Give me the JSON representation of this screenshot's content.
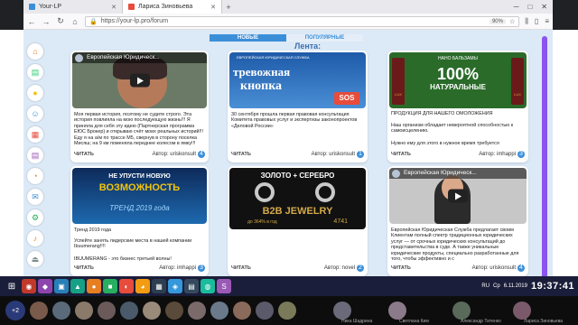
{
  "browser": {
    "tabs": [
      {
        "label": "Your-LP",
        "active": false
      },
      {
        "label": "Лариса Зиновьева",
        "active": true
      }
    ],
    "url": "https://your-lp.pro/forum",
    "zoom": "90%",
    "new_tab_icon": "plus"
  },
  "forum": {
    "tab_new": "НОВЫЕ",
    "tab_popular": "ПОПУЛЯРНЫЕ",
    "feed_title": "Лента:"
  },
  "cards": [
    {
      "media_type": "video",
      "video_title": "Европейская Юридическ...",
      "text": "Моя первая история, поэтому не судите строго. Эта история повлияла на мою последующую жизнь!!! Я приняла для себя эту идею (Партнерская программа ЕЮС Брокер) и открываю счёт моих реальных историй!!! Еду я на а/м по трассе М5, свернув в сторону поселка Мисяш; на 9 км поменяла переднее колесом в ямку!!!",
      "read": "ЧИТАТЬ",
      "author": "Автор: uriskonsult",
      "count": "4"
    },
    {
      "media_type": "sos",
      "banner_small": "ЕВРОПЕЙСКАЯ ЮРИДИЧЕСКАЯ СЛУЖБА",
      "banner_line1": "тревожная",
      "banner_line2": "кнопка",
      "banner_badge": "SOS",
      "text": "30 сентября прошла первая правовая консультация Комитета правовых услуг и экспертизы законопроектов «Деловой России»",
      "read": "ЧИТАТЬ",
      "author": "Автор: uriskonsult",
      "count": "1"
    },
    {
      "media_type": "lux",
      "banner_top": "НАНО БАЛЬЗАМЫ",
      "banner_pct": "100%",
      "banner_sub": "НАТУРАЛЬНЫЕ",
      "bottle_left": "LUX",
      "bottle_right": "LUX",
      "text_title": "ПРОДУКЦИЯ ДЛЯ НАШЕГО ОМОЛОЖЕНИЯ",
      "text": "Наш организм обладает невероятной способностью к самоисцелению.",
      "text2": "Нужно ему для этого в нужное время требуется",
      "read": "ЧИТАТЬ",
      "author": "Автор: imhappi",
      "count": "3"
    },
    {
      "media_type": "trend",
      "banner_top": "НЕ УПУСТИ НОВУЮ",
      "banner_mid": "ВОЗМОЖНОСТЬ",
      "banner_bottom": "ТРЕНД 2019 года",
      "text": "Тренд 2019 года",
      "text2": "Успейте занять лидерские места в нашей компании Ibuumerang!!!!",
      "text3": "IBUUMERANG - это бизнес третьей волны!",
      "read": "ЧИТАТЬ",
      "author": "Автор: imhappi",
      "count": "3"
    },
    {
      "media_type": "jewelry",
      "banner_top": "ЗОЛОТО + СЕРЕБРО",
      "banner_mid": "B2B JEWELRY",
      "banner_bottom": "до 364% в год",
      "banner_num": "4741",
      "text": "",
      "read": "ЧИТАТЬ",
      "author": "Автор: novel",
      "count": "2"
    },
    {
      "media_type": "video2",
      "video_title": "Европейская Юридическ...",
      "text": "Европейская Юридическая Служба предлагает своим Клиентам полный спектр традиционных юридических услуг — от срочных юридических консультаций до представительства в суде. А также уникальные юридические продукты, специально разработанные для того, чтобы эффективно и с",
      "read": "ЧИТАТЬ",
      "author": "Автор: uriskonsult",
      "count": "4"
    }
  ],
  "taskbar": {
    "lang": "RU",
    "day": "Ср",
    "date": "6.11.2019",
    "clock": "19:37:41"
  },
  "participants": {
    "count": "+2",
    "names": [
      "Ника Шадрина",
      "Светлана Ким",
      "Александр Титенко",
      "Лариса Зиновьева"
    ]
  }
}
